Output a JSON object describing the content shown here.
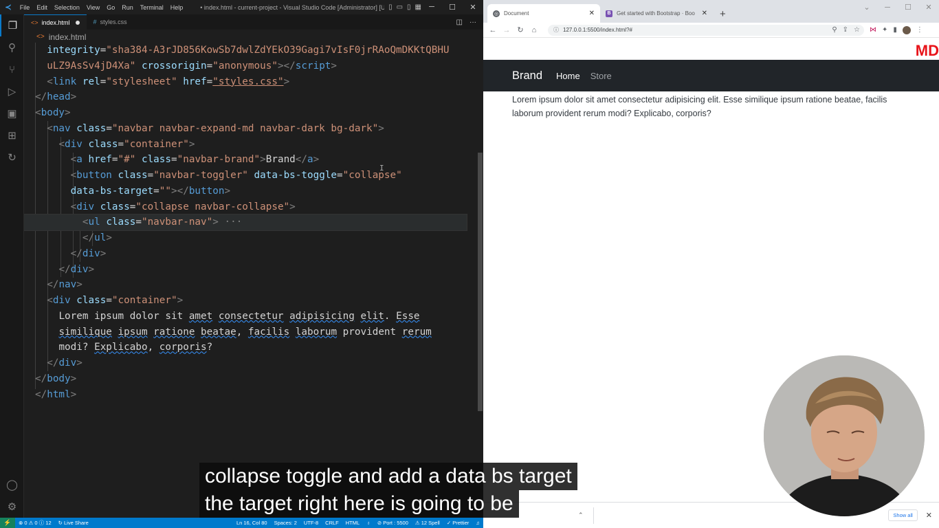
{
  "vscode": {
    "menu": [
      "File",
      "Edit",
      "Selection",
      "View",
      "Go",
      "Run",
      "Terminal",
      "Help"
    ],
    "window_title": "• index.html - current-project - Visual Studio Code [Administrator] [Unsup...",
    "tabs": [
      {
        "label": "index.html",
        "icon": "html-file-icon",
        "modified": true
      },
      {
        "label": "styles.css",
        "icon": "css-file-icon",
        "modified": false
      }
    ],
    "breadcrumb": "index.html",
    "status": {
      "problems": "⊗ 0 ⚠ 0 ⓘ 12",
      "live_share": "Live Share",
      "position": "Ln 16, Col 80",
      "spaces": "Spaces: 2",
      "encoding": "UTF-8",
      "eol": "CRLF",
      "language": "HTML",
      "port": "Port : 5500",
      "spell": "12 Spell",
      "prettier": "Prettier"
    }
  },
  "browser": {
    "tabs": [
      {
        "title": "Document",
        "active": true
      },
      {
        "title": "Get started with Bootstrap · Boo",
        "active": false
      }
    ],
    "url": "127.0.0.1:5500/index.html?#",
    "logo": "MD",
    "page": {
      "brand": "Brand",
      "nav_links": [
        "Home",
        "Store"
      ],
      "content": "Lorem ipsum dolor sit amet consectetur adipisicing elit. Esse similique ipsum ratione beatae, facilis laborum provident rerum modi? Explicabo, corporis?"
    },
    "downloads": {
      "show_all": "Show all"
    }
  },
  "captions": {
    "line1": "collapse toggle and add a data bs target",
    "line2": "the target right here is going to be"
  }
}
